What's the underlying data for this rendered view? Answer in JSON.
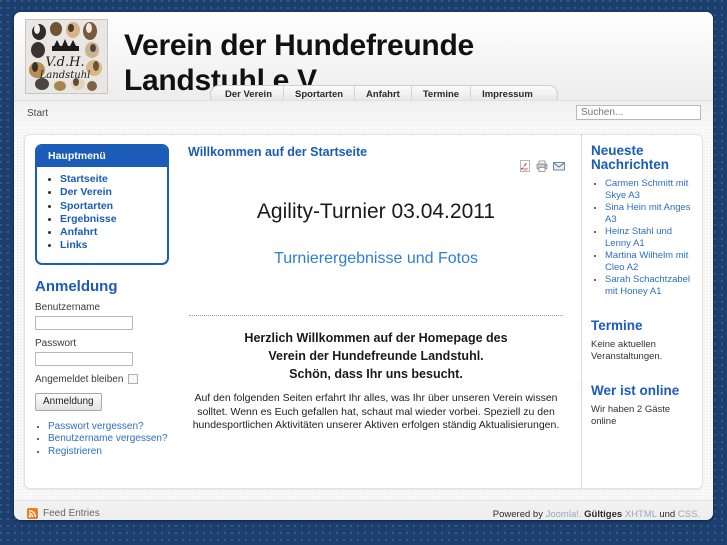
{
  "header": {
    "site_title": "Verein der Hundefreunde\nLandstuhl e.V.",
    "logo_alt": "V.d.H. Landstuhl",
    "logo_initials": "V.d.H.",
    "logo_subtext": "Landstuhl"
  },
  "topnav": {
    "items": [
      {
        "label": "Der Verein"
      },
      {
        "label": "Sportarten"
      },
      {
        "label": "Anfahrt"
      },
      {
        "label": "Termine"
      },
      {
        "label": "Impressum"
      }
    ]
  },
  "subbar": {
    "breadcrumb": "Start",
    "search_placeholder": "Suchen...",
    "search_value": ""
  },
  "sidebar_left": {
    "menu_title": "Hauptmenü",
    "menu_items": [
      {
        "label": "Startseite"
      },
      {
        "label": "Der Verein"
      },
      {
        "label": "Sportarten"
      },
      {
        "label": "Ergebnisse"
      },
      {
        "label": "Anfahrt"
      },
      {
        "label": "Links"
      }
    ],
    "login": {
      "title": "Anmeldung",
      "username_label": "Benutzername",
      "username_value": "",
      "password_label": "Passwort",
      "password_value": "",
      "remember_label": "Angemeldet bleiben",
      "submit_label": "Anmeldung",
      "links": [
        {
          "label": "Passwort vergessen?"
        },
        {
          "label": "Benutzername vergessen?"
        },
        {
          "label": "Registrieren"
        }
      ]
    }
  },
  "main": {
    "page_heading": "Willkommen auf der Startseite",
    "icons": [
      {
        "name": "pdf-icon"
      },
      {
        "name": "print-icon"
      },
      {
        "name": "email-icon"
      }
    ],
    "headline": "Agility-Turnier 03.04.2011",
    "sublink": "Turnierergebnisse und Fotos",
    "welcome_lines": "Herzlich Willkommen auf der Homepage des\nVerein der Hundefreunde Landstuhl.\nSchön, dass Ihr uns besucht.",
    "welcome_paragraph": "Auf den folgenden Seiten erfahrt Ihr alles, was Ihr über unseren Verein wissen solltet. Wenn es Euch gefallen hat, schaut mal wieder vorbei. Speziell zu den hundesportlichen Aktivitäten unserer Aktiven erfolgen ständig Aktualisierungen."
  },
  "sidebar_right": {
    "news_title": "Neueste Nachrichten",
    "news_items": [
      {
        "label": "Carmen Schmitt mit Skye A3"
      },
      {
        "label": "Sina Hein mit Anges A3"
      },
      {
        "label": "Heinz Stahl und Lenny A1"
      },
      {
        "label": "Martina Wilhelm mit Cleo A2"
      },
      {
        "label": "Sarah Schachtzabel mit Honey A1"
      }
    ],
    "events_title": "Termine",
    "events_text": "Keine aktuellen Veranstaltungen.",
    "online_title": "Wer ist online",
    "online_text": "Wir haben 2 Gäste online"
  },
  "footer": {
    "feed_label": "Feed Entries",
    "powered_prefix": "Powered by",
    "joomla_label": "Joomla!.",
    "valid_label": "Gültiges",
    "xhtml_label": "XHTML",
    "und_label": "und",
    "css_label": "CSS."
  },
  "colors": {
    "page_background": "#1c3f6e",
    "accent_blue": "#1a5cb8",
    "link_blue": "#2d6fc4",
    "rss_orange": "#ee7b1e",
    "pdf_red": "#c8312b"
  }
}
